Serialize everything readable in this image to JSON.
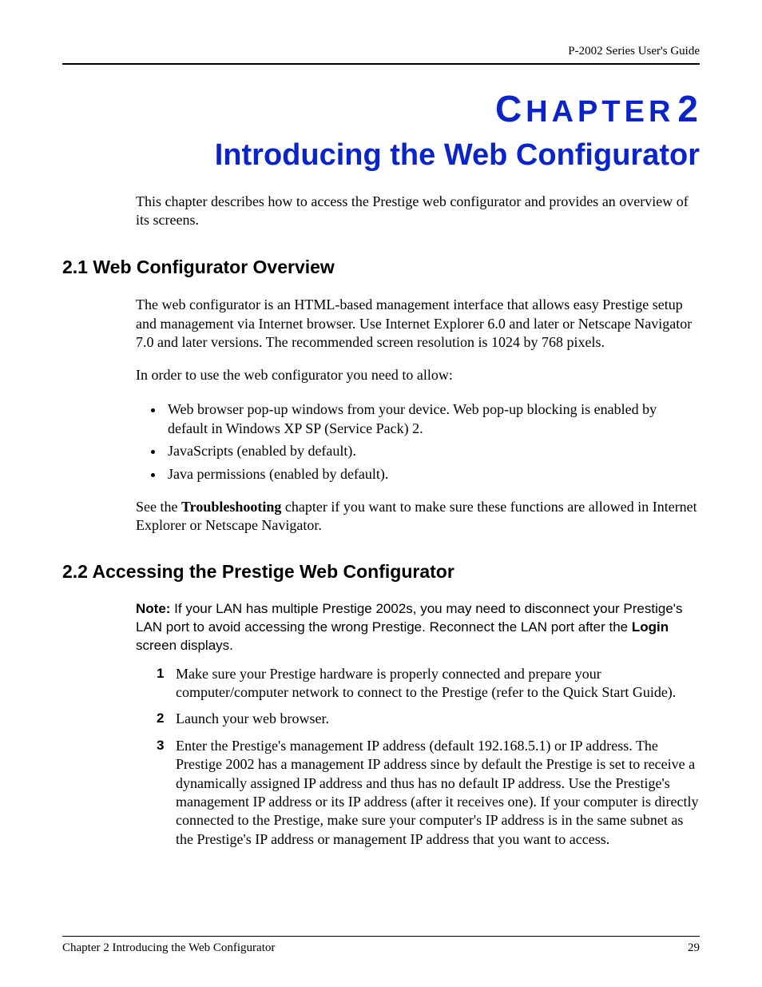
{
  "header": {
    "doc_title": "P-2002 Series User's Guide"
  },
  "chapter": {
    "label_prefix": "C",
    "label_rest": "HAPTER",
    "number": "2",
    "title": "Introducing the Web Configurator"
  },
  "intro": "This chapter describes how to access the Prestige web configurator and provides an overview of its screens.",
  "section1": {
    "heading": "2.1  Web Configurator Overview",
    "para1": "The web configurator is an HTML-based management interface that allows easy Prestige setup and management via Internet browser. Use Internet Explorer 6.0 and later or Netscape Navigator 7.0 and later versions. The recommended screen resolution is 1024 by 768 pixels.",
    "para2": "In order to use the web configurator you need to allow:",
    "bullets": [
      "Web browser pop-up windows from your device. Web pop-up blocking is enabled by default in Windows XP SP (Service Pack) 2.",
      "JavaScripts (enabled by default).",
      "Java permissions (enabled by default)."
    ],
    "para3_pre": "See the ",
    "para3_bold": "Troubleshooting",
    "para3_post": " chapter if you want to make sure these functions are allowed in Internet Explorer or Netscape Navigator."
  },
  "section2": {
    "heading": "2.2  Accessing the Prestige Web Configurator",
    "note_label": "Note:",
    "note_text_1": " If your LAN has multiple Prestige 2002s, you may need to disconnect your Prestige's LAN port to avoid accessing the wrong Prestige. Reconnect the LAN port after the ",
    "note_bold": "Login",
    "note_text_2": " screen displays.",
    "steps": [
      {
        "n": "1",
        "text": "Make sure your Prestige hardware is properly connected and prepare your computer/computer network to connect to the Prestige (refer to the Quick Start Guide)."
      },
      {
        "n": "2",
        "text": "Launch your web browser."
      },
      {
        "n": "3",
        "text": "Enter the Prestige's management IP address (default 192.168.5.1) or IP address. The Prestige 2002 has a management IP address since by default the Prestige is set to receive a dynamically assigned IP address and thus has no default IP address. Use the Prestige's management IP address or its IP address (after it receives one). If your computer is directly connected to the Prestige, make sure your computer's IP address is in the same subnet as the Prestige's IP address or management IP address that you want to access."
      }
    ]
  },
  "footer": {
    "left": "Chapter 2 Introducing the Web Configurator",
    "right": "29"
  }
}
